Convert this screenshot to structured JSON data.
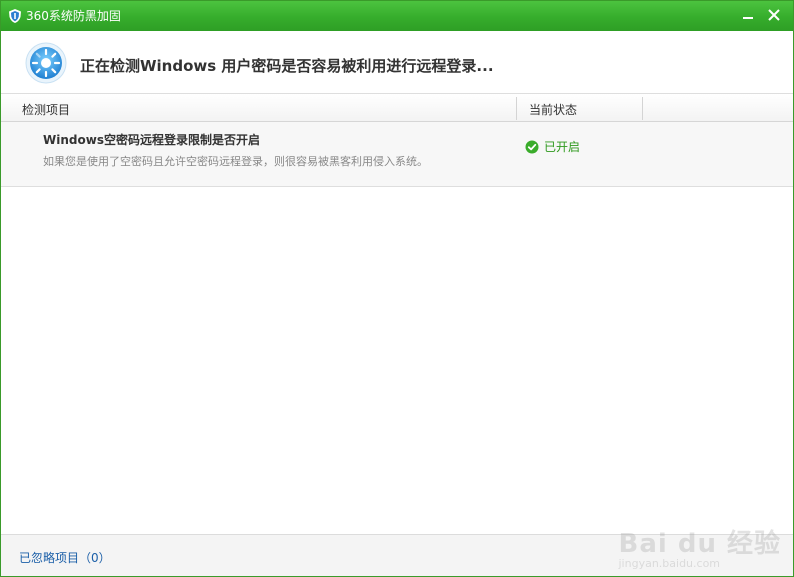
{
  "window": {
    "title": "360系统防黑加固"
  },
  "header": {
    "scanning_text": "正在检测Windows 用户密码是否容易被利用进行远程登录..."
  },
  "table": {
    "columns": [
      "检测项目",
      "当前状态"
    ],
    "rows": [
      {
        "title": "Windows空密码远程登录限制是否开启",
        "description": "如果您是使用了空密码且允许空密码远程登录，则很容易被黑客利用侵入系统。",
        "status": "已开启"
      }
    ]
  },
  "footer": {
    "ignored_link": "已忽略项目（0）"
  },
  "watermark": {
    "main": "Bai du 经验",
    "sub": "jingyan.baidu.com"
  },
  "colors": {
    "titlebar": "#36ad2c",
    "status_ok": "#2f9a1e",
    "link": "#1b5fa8"
  }
}
